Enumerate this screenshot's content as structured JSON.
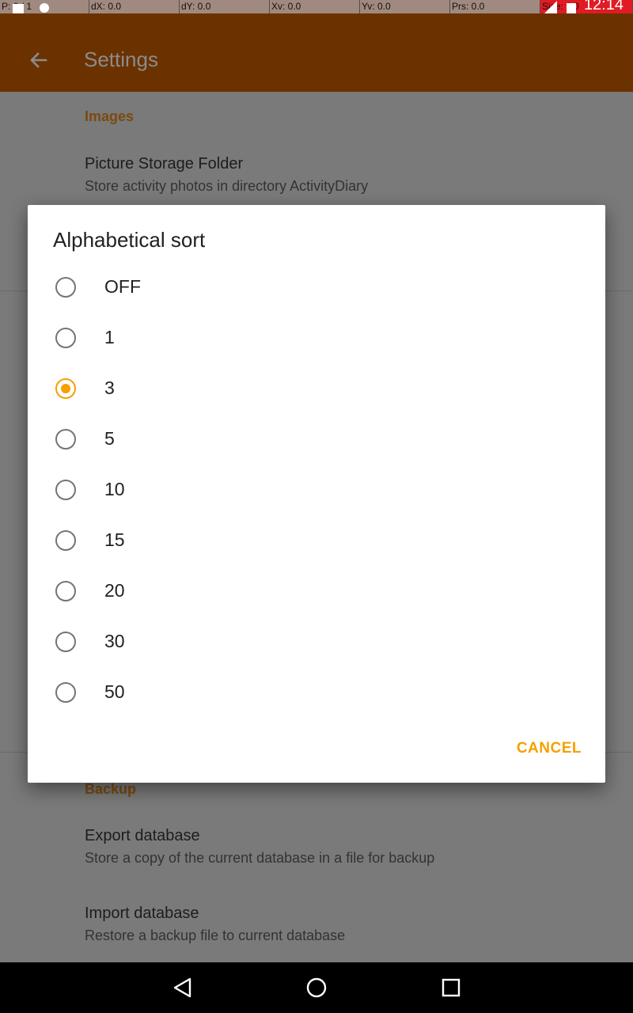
{
  "status_bar": {
    "cells": [
      "P: 0 / 1",
      "dX: 0.0",
      "dY: 0.0",
      "Xv: 0.0",
      "Yv: 0.0",
      "Prs: 0.0",
      "Size: 1.0"
    ],
    "time": "12:14"
  },
  "app_bar": {
    "title": "Settings",
    "back_icon": "arrow-back-icon"
  },
  "settings": {
    "images_section": "Images",
    "picture_storage": {
      "title": "Picture Storage Folder",
      "summary": "Store activity photos in directory ActivityDiary"
    },
    "backup_section": "Backup",
    "export": {
      "title": "Export database",
      "summary": "Store a copy of the current database in a file for backup"
    },
    "import": {
      "title": "Import database",
      "summary": "Restore a backup file to current database"
    }
  },
  "dialog": {
    "title": "Alphabetical sort",
    "options": [
      "OFF",
      "1",
      "3",
      "5",
      "10",
      "15",
      "20",
      "30",
      "50"
    ],
    "selected": "3",
    "cancel_label": "CANCEL"
  },
  "colors": {
    "accent": "#f5a000",
    "app_bar": "#6b3200"
  },
  "nav_bar": {
    "icons": [
      "back-triangle-icon",
      "home-circle-icon",
      "recents-square-icon"
    ]
  }
}
